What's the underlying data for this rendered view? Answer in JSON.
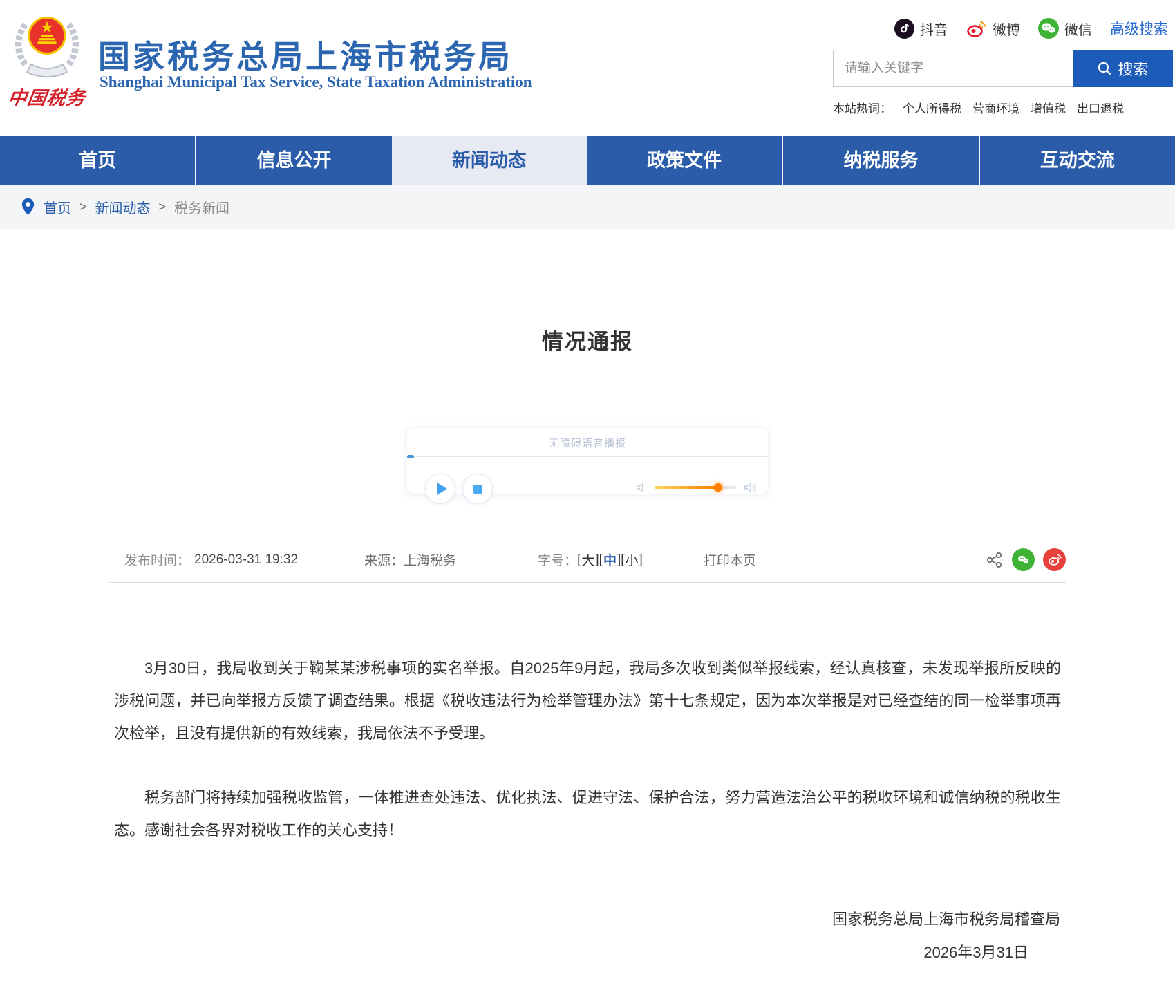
{
  "header": {
    "logo_caption": "中国税务",
    "site_title": "国家税务总局上海市税务局",
    "site_subtitle": "Shanghai Municipal Tax Service, State Taxation Administration",
    "social": {
      "douyin": "抖音",
      "weibo": "微博",
      "wechat": "微信"
    },
    "advanced_search": "高级搜索",
    "search": {
      "placeholder": "请输入关键字",
      "button": "搜索",
      "value": ""
    },
    "hot_words_label": "本站热词：",
    "hot_words": [
      "个人所得税",
      "营商环境",
      "增值税",
      "出口退税"
    ]
  },
  "nav": {
    "items": [
      {
        "label": "首页",
        "active": false
      },
      {
        "label": "信息公开",
        "active": false
      },
      {
        "label": "新闻动态",
        "active": true
      },
      {
        "label": "政策文件",
        "active": false
      },
      {
        "label": "纳税服务",
        "active": false
      },
      {
        "label": "互动交流",
        "active": false
      }
    ]
  },
  "breadcrumb": {
    "items": [
      "首页",
      "新闻动态",
      "税务新闻"
    ],
    "separator": ">"
  },
  "article": {
    "title": "情况通报",
    "player": {
      "caption": "无障碍语音播报",
      "volume_percent": 78
    },
    "meta": {
      "publish_label": "发布时间：",
      "publish_value": "2026-03-31 19:32",
      "source_label": "来源：",
      "source_value": "上海税务",
      "fontsize_label": "字号：",
      "bracket_open": "[",
      "bracket_close": "]",
      "fontsize_options": [
        "大",
        "中",
        "小"
      ],
      "fontsize_selected": "中",
      "print_label": "打印本页"
    },
    "paragraphs": [
      "3月30日，我局收到关于鞠某某涉税事项的实名举报。自2025年9月起，我局多次收到类似举报线索，经认真核查，未发现举报所反映的涉税问题，并已向举报方反馈了调查结果。根据《税收违法行为检举管理办法》第十七条规定，因为本次举报是对已经查结的同一检举事项再次检举，且没有提供新的有效线索，我局依法不予受理。",
      "税务部门将持续加强税收监管，一体推进查处违法、优化执法、促进守法、保护合法，努力营造法治公平的税收环境和诚信纳税的税收生态。感谢社会各界对税收工作的关心支持！"
    ],
    "signature": "国家税务总局上海市税务局稽查局",
    "date": "2026年3月31日"
  },
  "colors": {
    "brand_blue": "#2a5caa",
    "title_blue": "#2c65b0",
    "link_blue": "#2a6bd2",
    "button_blue": "#1d5bb8",
    "active_tab_bg": "#e7eaf2",
    "wechat_green": "#3eb335",
    "weibo_red": "#e6162d",
    "douyin_black": "#1b0f1f",
    "slider_orange": "#ff7d00",
    "logo_red": "#d4212a"
  }
}
